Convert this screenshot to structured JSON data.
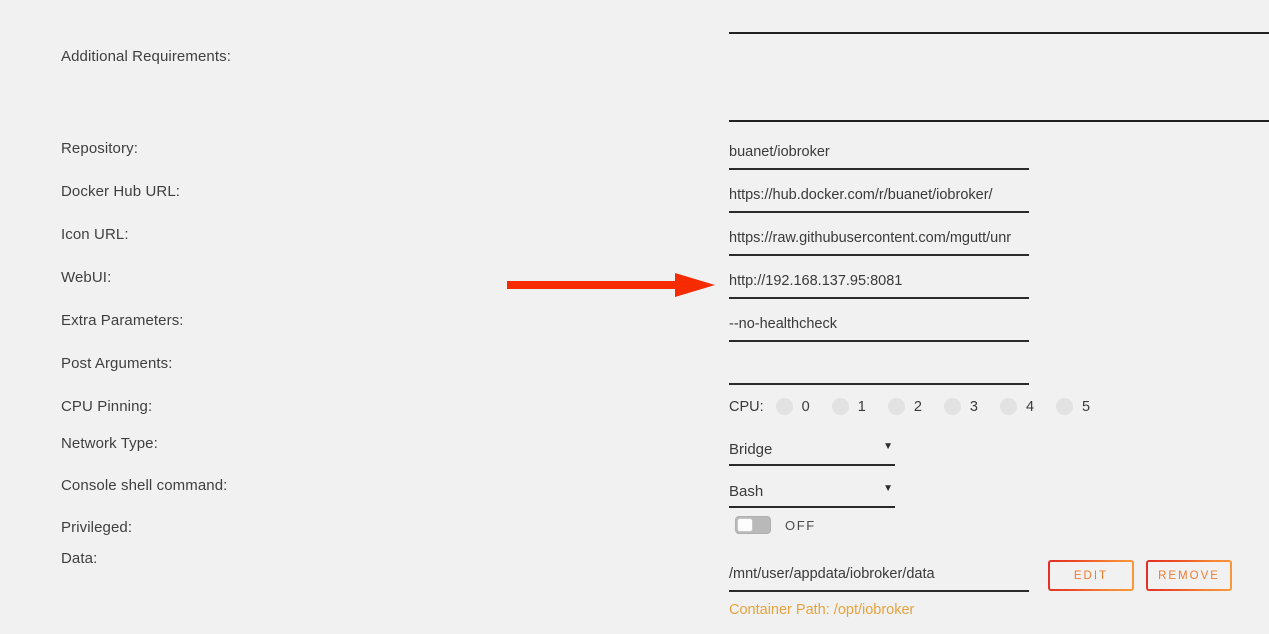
{
  "form": {
    "rows": [
      {
        "label": "Additional Requirements:",
        "value": "",
        "control": "textarea-wide"
      },
      {
        "label": "Repository:",
        "value": "buanet/iobroker",
        "control": "text"
      },
      {
        "label": "Docker Hub URL:",
        "value": "https://hub.docker.com/r/buanet/iobroker/",
        "control": "text"
      },
      {
        "label": "Icon URL:",
        "value": "https://raw.githubusercontent.com/mgutt/unraid-docker-templates/main/mgutt/images/iobroker.png",
        "control": "text"
      },
      {
        "label": "WebUI:",
        "value": "http://192.168.137.95:8081",
        "control": "text"
      },
      {
        "label": "Extra Parameters:",
        "value": "--no-healthcheck",
        "control": "text"
      },
      {
        "label": "Post Arguments:",
        "value": "",
        "control": "text"
      },
      {
        "label": "CPU Pinning:",
        "value": "",
        "control": "cpu"
      },
      {
        "label": "Network Type:",
        "value": "Bridge",
        "control": "select"
      },
      {
        "label": "Console shell command:",
        "value": "Bash",
        "control": "select"
      },
      {
        "label": "Privileged:",
        "value": "OFF",
        "control": "toggle"
      },
      {
        "label": "Data:",
        "value": "/mnt/user/appdata/iobroker/data",
        "control": "path"
      }
    ]
  },
  "labels": {
    "additional_requirements": "Additional Requirements:",
    "repository": "Repository:",
    "docker_hub_url": "Docker Hub URL:",
    "icon_url": "Icon URL:",
    "webui": "WebUI:",
    "extra_parameters": "Extra Parameters:",
    "post_arguments": "Post Arguments:",
    "cpu_pinning": "CPU Pinning:",
    "network_type": "Network Type:",
    "console_shell_command": "Console shell command:",
    "privileged": "Privileged:",
    "data": "Data:"
  },
  "values": {
    "additional_requirements": "",
    "extra_requirements": "",
    "repository": "buanet/iobroker",
    "docker_hub_url": "https://hub.docker.com/r/buanet/iobroker/",
    "icon_url": "https://raw.githubusercontent.com/mgutt/unr",
    "webui": "http://192.168.137.95:8081",
    "extra_parameters": "--no-healthcheck",
    "post_arguments": "",
    "data_path": "/mnt/user/appdata/iobroker/data"
  },
  "cpu": {
    "label": "CPU:",
    "cores": [
      "0",
      "1",
      "2",
      "3",
      "4",
      "5"
    ],
    "selected": null
  },
  "network_type": {
    "selected": "Bridge",
    "options": [
      "Bridge"
    ]
  },
  "console_shell": {
    "selected": "Bash",
    "options": [
      "Bash"
    ]
  },
  "privileged": {
    "state": "OFF",
    "on": false
  },
  "data_row": {
    "path": "/mnt/user/appdata/iobroker/data",
    "edit_label": "EDIT",
    "remove_label": "REMOVE",
    "container_path": "Container Path: /opt/iobroker"
  },
  "annotation": {
    "type": "arrow",
    "points_to": "webui-input",
    "color": "#f62b00"
  },
  "colors": {
    "background": "#f1f1f1",
    "text": "#3a3a3a",
    "underline": "#2b2b2b",
    "accent_orange": "#f07c32",
    "container_path": "#e8a33d",
    "gradient_start": "#e12d27",
    "gradient_end": "#f99a3c",
    "arrow": "#f62b00",
    "radio": "#e2e2e2"
  }
}
